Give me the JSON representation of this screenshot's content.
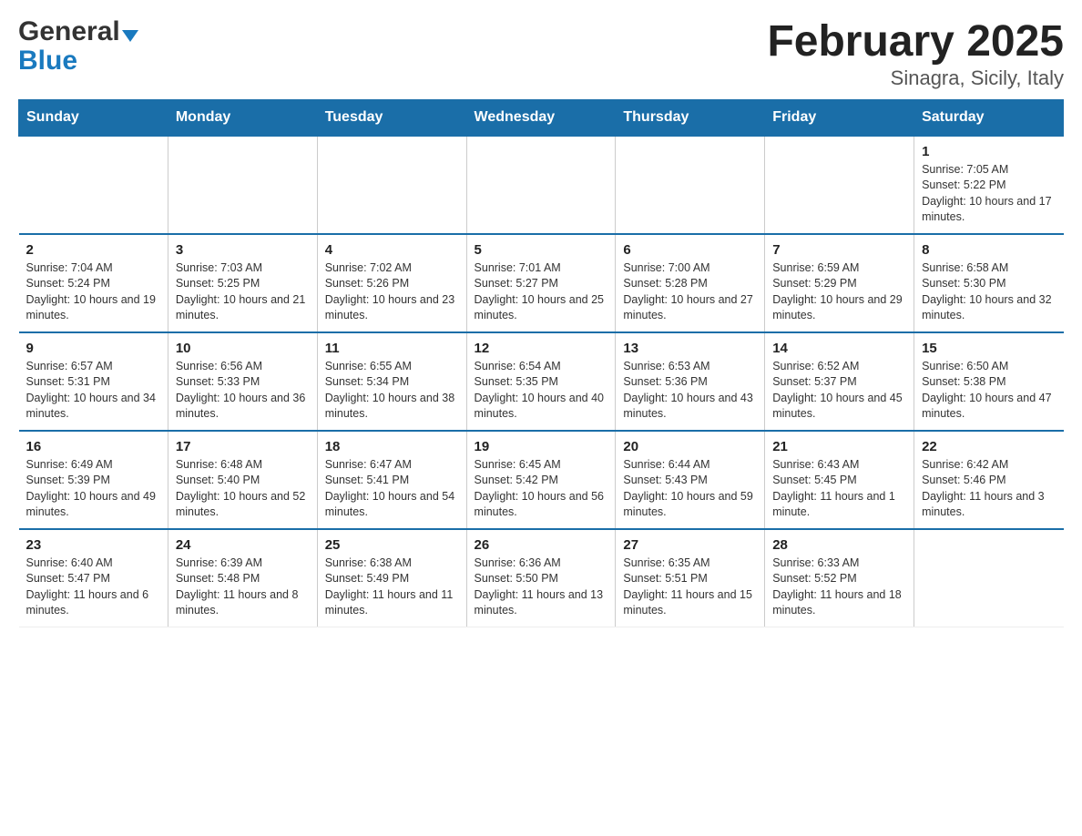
{
  "logo": {
    "general": "General",
    "blue": "Blue"
  },
  "title": "February 2025",
  "subtitle": "Sinagra, Sicily, Italy",
  "days_of_week": [
    "Sunday",
    "Monday",
    "Tuesday",
    "Wednesday",
    "Thursday",
    "Friday",
    "Saturday"
  ],
  "weeks": [
    [
      {
        "day": "",
        "info": ""
      },
      {
        "day": "",
        "info": ""
      },
      {
        "day": "",
        "info": ""
      },
      {
        "day": "",
        "info": ""
      },
      {
        "day": "",
        "info": ""
      },
      {
        "day": "",
        "info": ""
      },
      {
        "day": "1",
        "info": "Sunrise: 7:05 AM\nSunset: 5:22 PM\nDaylight: 10 hours and 17 minutes."
      }
    ],
    [
      {
        "day": "2",
        "info": "Sunrise: 7:04 AM\nSunset: 5:24 PM\nDaylight: 10 hours and 19 minutes."
      },
      {
        "day": "3",
        "info": "Sunrise: 7:03 AM\nSunset: 5:25 PM\nDaylight: 10 hours and 21 minutes."
      },
      {
        "day": "4",
        "info": "Sunrise: 7:02 AM\nSunset: 5:26 PM\nDaylight: 10 hours and 23 minutes."
      },
      {
        "day": "5",
        "info": "Sunrise: 7:01 AM\nSunset: 5:27 PM\nDaylight: 10 hours and 25 minutes."
      },
      {
        "day": "6",
        "info": "Sunrise: 7:00 AM\nSunset: 5:28 PM\nDaylight: 10 hours and 27 minutes."
      },
      {
        "day": "7",
        "info": "Sunrise: 6:59 AM\nSunset: 5:29 PM\nDaylight: 10 hours and 29 minutes."
      },
      {
        "day": "8",
        "info": "Sunrise: 6:58 AM\nSunset: 5:30 PM\nDaylight: 10 hours and 32 minutes."
      }
    ],
    [
      {
        "day": "9",
        "info": "Sunrise: 6:57 AM\nSunset: 5:31 PM\nDaylight: 10 hours and 34 minutes."
      },
      {
        "day": "10",
        "info": "Sunrise: 6:56 AM\nSunset: 5:33 PM\nDaylight: 10 hours and 36 minutes."
      },
      {
        "day": "11",
        "info": "Sunrise: 6:55 AM\nSunset: 5:34 PM\nDaylight: 10 hours and 38 minutes."
      },
      {
        "day": "12",
        "info": "Sunrise: 6:54 AM\nSunset: 5:35 PM\nDaylight: 10 hours and 40 minutes."
      },
      {
        "day": "13",
        "info": "Sunrise: 6:53 AM\nSunset: 5:36 PM\nDaylight: 10 hours and 43 minutes."
      },
      {
        "day": "14",
        "info": "Sunrise: 6:52 AM\nSunset: 5:37 PM\nDaylight: 10 hours and 45 minutes."
      },
      {
        "day": "15",
        "info": "Sunrise: 6:50 AM\nSunset: 5:38 PM\nDaylight: 10 hours and 47 minutes."
      }
    ],
    [
      {
        "day": "16",
        "info": "Sunrise: 6:49 AM\nSunset: 5:39 PM\nDaylight: 10 hours and 49 minutes."
      },
      {
        "day": "17",
        "info": "Sunrise: 6:48 AM\nSunset: 5:40 PM\nDaylight: 10 hours and 52 minutes."
      },
      {
        "day": "18",
        "info": "Sunrise: 6:47 AM\nSunset: 5:41 PM\nDaylight: 10 hours and 54 minutes."
      },
      {
        "day": "19",
        "info": "Sunrise: 6:45 AM\nSunset: 5:42 PM\nDaylight: 10 hours and 56 minutes."
      },
      {
        "day": "20",
        "info": "Sunrise: 6:44 AM\nSunset: 5:43 PM\nDaylight: 10 hours and 59 minutes."
      },
      {
        "day": "21",
        "info": "Sunrise: 6:43 AM\nSunset: 5:45 PM\nDaylight: 11 hours and 1 minute."
      },
      {
        "day": "22",
        "info": "Sunrise: 6:42 AM\nSunset: 5:46 PM\nDaylight: 11 hours and 3 minutes."
      }
    ],
    [
      {
        "day": "23",
        "info": "Sunrise: 6:40 AM\nSunset: 5:47 PM\nDaylight: 11 hours and 6 minutes."
      },
      {
        "day": "24",
        "info": "Sunrise: 6:39 AM\nSunset: 5:48 PM\nDaylight: 11 hours and 8 minutes."
      },
      {
        "day": "25",
        "info": "Sunrise: 6:38 AM\nSunset: 5:49 PM\nDaylight: 11 hours and 11 minutes."
      },
      {
        "day": "26",
        "info": "Sunrise: 6:36 AM\nSunset: 5:50 PM\nDaylight: 11 hours and 13 minutes."
      },
      {
        "day": "27",
        "info": "Sunrise: 6:35 AM\nSunset: 5:51 PM\nDaylight: 11 hours and 15 minutes."
      },
      {
        "day": "28",
        "info": "Sunrise: 6:33 AM\nSunset: 5:52 PM\nDaylight: 11 hours and 18 minutes."
      },
      {
        "day": "",
        "info": ""
      }
    ]
  ]
}
